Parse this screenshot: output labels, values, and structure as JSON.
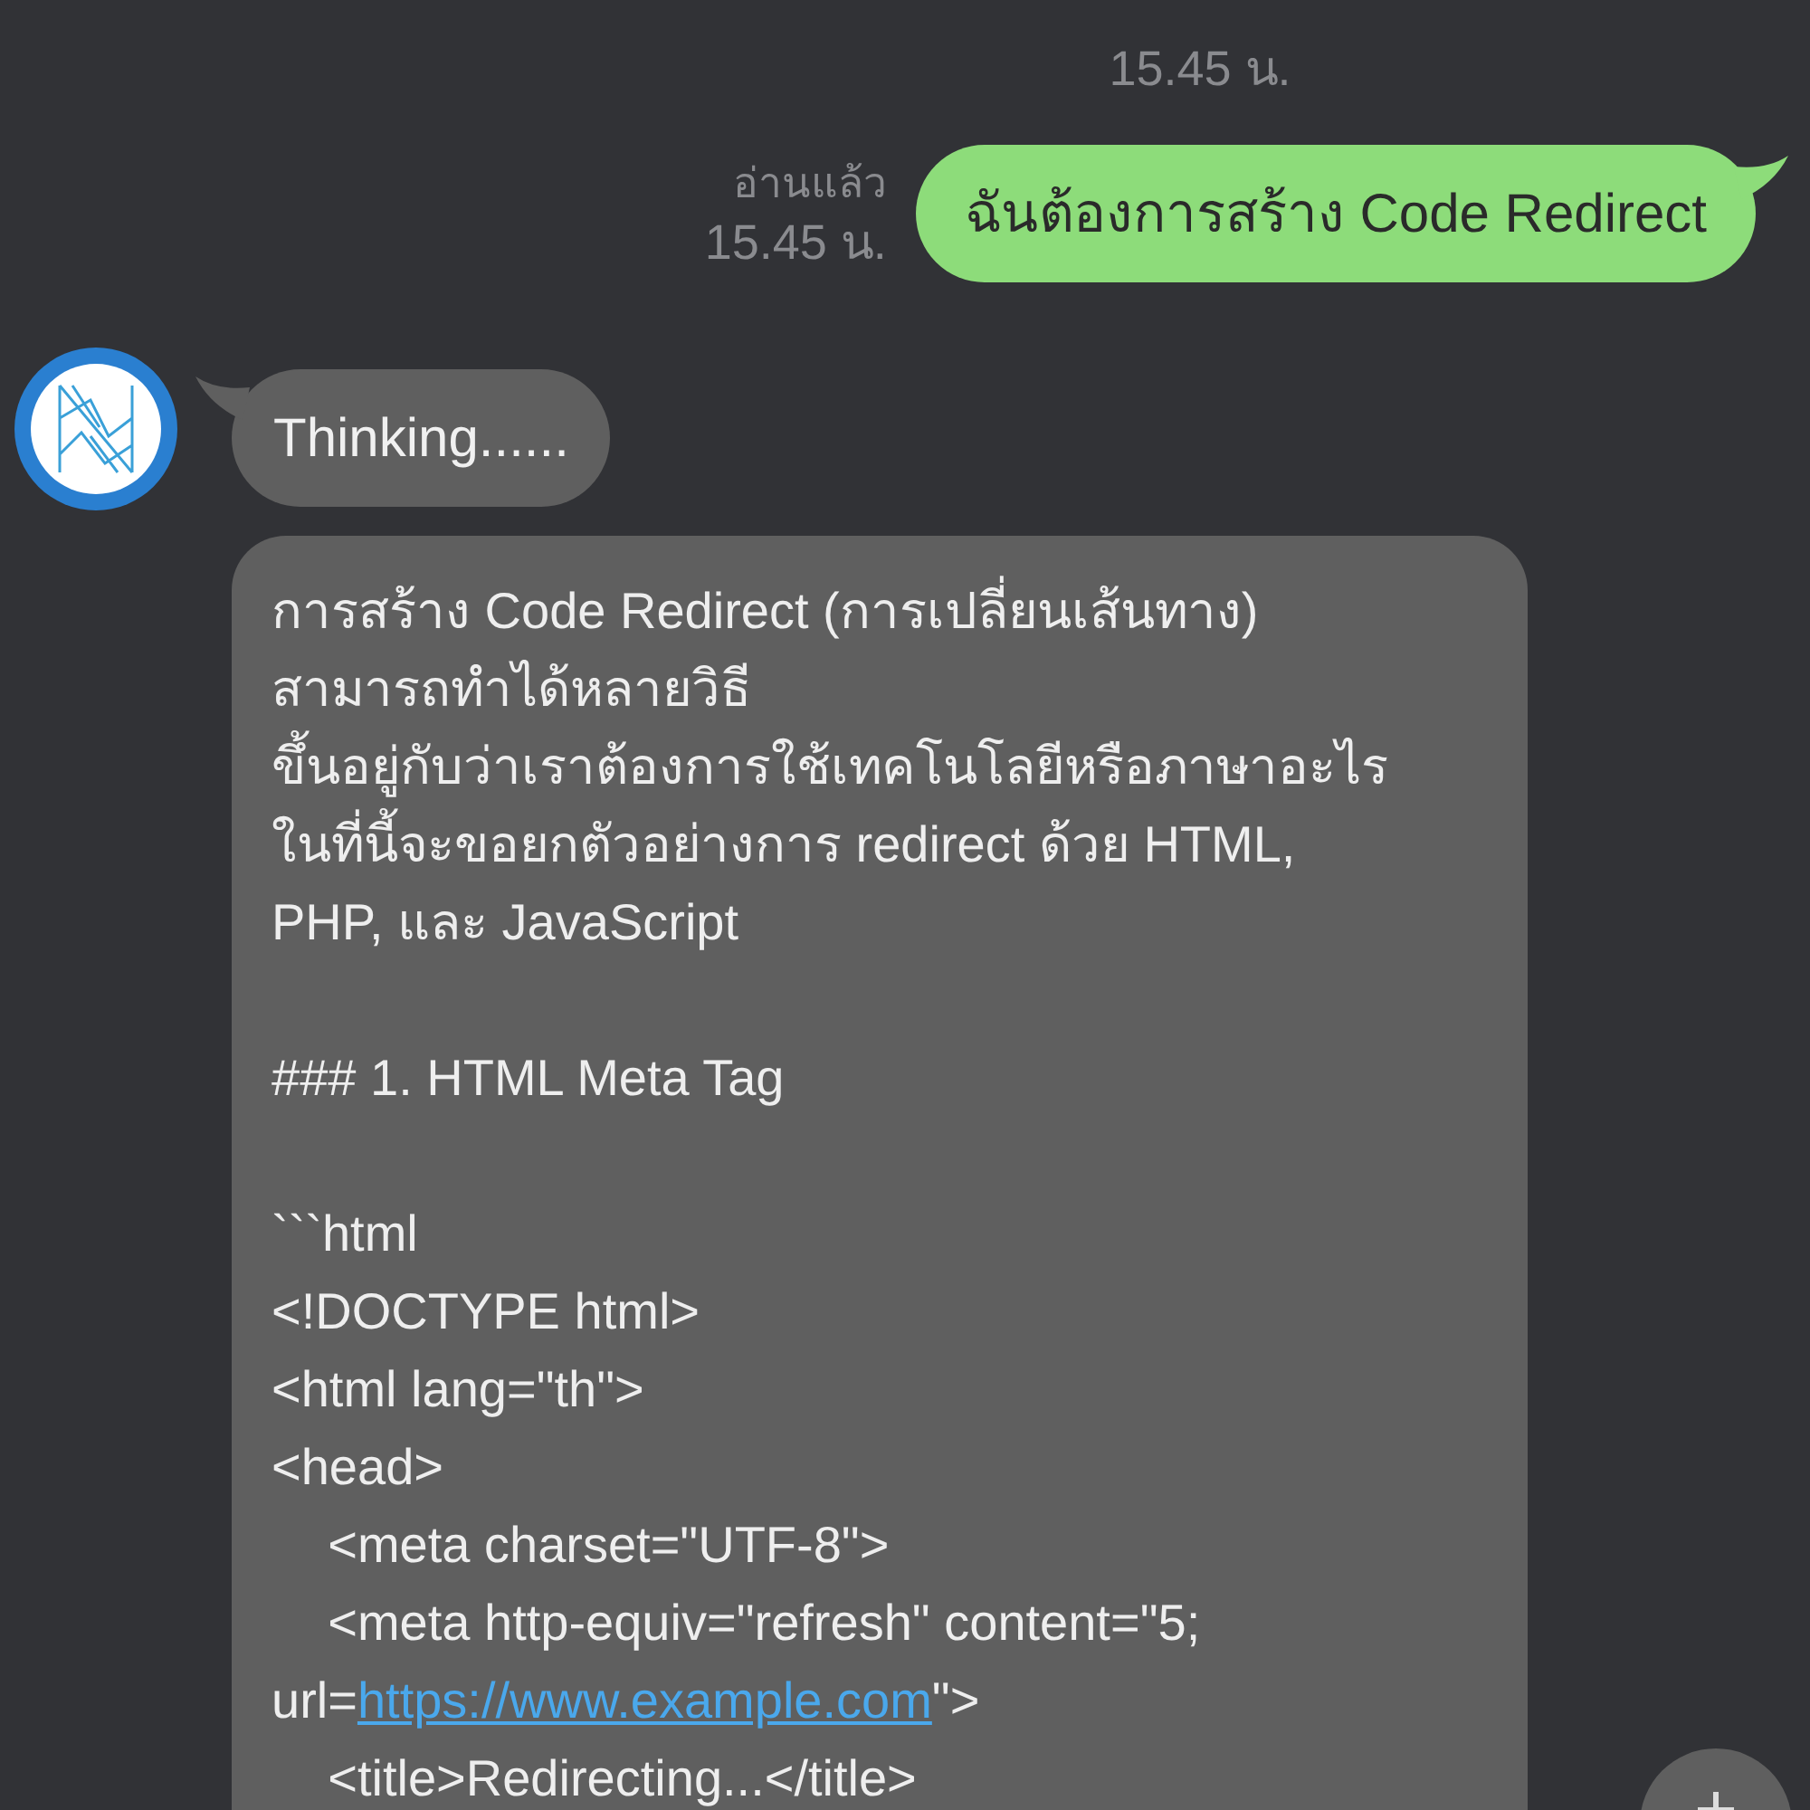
{
  "top_time": "15.45 น.",
  "sent": {
    "status": "อ่านแล้ว",
    "time": "15.45 น.",
    "text": "ฉันต้องการสร้าง Code Redirect"
  },
  "thinking": {
    "text": "Thinking......"
  },
  "reply": {
    "paragraphs": [
      [
        {
          "parts": [
            {
              "text": "การสร้าง Code Redirect (การเปลี่ยนเส้นทาง)"
            }
          ]
        },
        {
          "parts": [
            {
              "text": "สามารถทำได้หลายวิธี"
            }
          ]
        },
        {
          "parts": [
            {
              "text": "ขึ้นอยู่กับว่าเราต้องการใช้เทคโนโลยีหรือภาษาอะไร"
            }
          ]
        },
        {
          "parts": [
            {
              "text": "ในที่นี้จะขอยกตัวอย่างการ redirect ด้วย HTML,"
            }
          ]
        },
        {
          "parts": [
            {
              "text": "PHP, และ JavaScript"
            }
          ]
        }
      ],
      [
        {
          "parts": [
            {
              "text": "### 1. HTML Meta Tag"
            }
          ]
        }
      ],
      [
        {
          "parts": [
            {
              "text": "```html"
            }
          ]
        },
        {
          "parts": [
            {
              "text": "<!DOCTYPE html>"
            }
          ]
        },
        {
          "parts": [
            {
              "text": "<html lang=\"th\">"
            }
          ]
        },
        {
          "parts": [
            {
              "text": "<head>"
            }
          ]
        },
        {
          "parts": [
            {
              "text": "    <meta charset=\"UTF-8\">"
            }
          ]
        },
        {
          "parts": [
            {
              "text": "    <meta http-equiv=\"refresh\" content=\"5;"
            }
          ]
        },
        {
          "parts": [
            {
              "text": "url="
            },
            {
              "text": "https://www.example.com",
              "link": true
            },
            {
              "text": "\">"
            }
          ]
        },
        {
          "parts": [
            {
              "text": "    <title>Redirecting...</title>"
            }
          ]
        }
      ]
    ]
  }
}
